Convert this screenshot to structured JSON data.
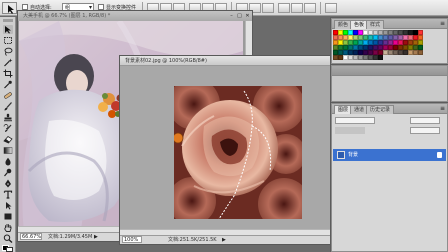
{
  "options_bar": {
    "auto_select_label": "自动选择:",
    "auto_select_value": "组",
    "show_transform_label": "显示变换控件"
  },
  "documents": [
    {
      "title": "大美手机 @ 66.7% (图层 1, RGB/8) *",
      "zoom": "66.67%",
      "doc_info": "文档:1.29M/3.45M"
    },
    {
      "title": "背景素材02.jpg @ 100%(RGB/8#)",
      "zoom": "100%",
      "doc_info": "文档:251.5K/251.5K"
    }
  ],
  "panels": {
    "swatches_tabs": [
      "颜色",
      "色板",
      "样式"
    ],
    "history_tabs": [
      "图层",
      "通道",
      "历史记录"
    ],
    "layer_name": "背景"
  },
  "colors": {
    "workspace": "#6b6b6b",
    "panel": "#d4d4d4",
    "layer_selected": "#3b72d0"
  },
  "swatches": [
    "#ff0000",
    "#ffff00",
    "#00ff00",
    "#00ffff",
    "#0000ff",
    "#ff00ff",
    "#ffffff",
    "#e6e6e6",
    "#cccccc",
    "#b3b3b3",
    "#999999",
    "#808080",
    "#666666",
    "#4d4d4d",
    "#333333",
    "#1a1a1a",
    "#000000",
    "#ff3333",
    "#f26c4f",
    "#f68e55",
    "#fbaf5c",
    "#fff467",
    "#acd372",
    "#7cc576",
    "#3bb878",
    "#1abbb4",
    "#00bff3",
    "#438ccb",
    "#5574b9",
    "#605ca8",
    "#855fa8",
    "#a763a8",
    "#f06ea9",
    "#f26d7d",
    "#ed1c24",
    "#f26522",
    "#f7941d",
    "#fff200",
    "#8dc63f",
    "#39b54a",
    "#00a651",
    "#00a99d",
    "#00aeef",
    "#0072bc",
    "#0054a6",
    "#2e3192",
    "#662d91",
    "#92278f",
    "#ec008c",
    "#ed145b",
    "#9e0b0f",
    "#a0410d",
    "#a36209",
    "#aba000",
    "#598527",
    "#1a7b30",
    "#007236",
    "#00746b",
    "#0076a3",
    "#004b80",
    "#003471",
    "#1b1464",
    "#440e62",
    "#630460",
    "#9e005d",
    "#9e0039",
    "#790000",
    "#7b2e00",
    "#7d4900",
    "#827b00",
    "#406618",
    "#005e20",
    "#005826",
    "#005952",
    "#005b7f",
    "#003663",
    "#002157",
    "#0d004c",
    "#32004b",
    "#4b0049",
    "#7b0046",
    "#7a0026",
    "#c7b299",
    "#998675",
    "#736357",
    "#534741",
    "#37302d",
    "#c69c6d",
    "#a67c52",
    "#8c6239",
    "#754c24",
    "#603913",
    "#ffffff",
    "#dddddd",
    "#bbbbbb",
    "#999999",
    "#777777",
    "#555555",
    "#333333",
    "#111111"
  ]
}
